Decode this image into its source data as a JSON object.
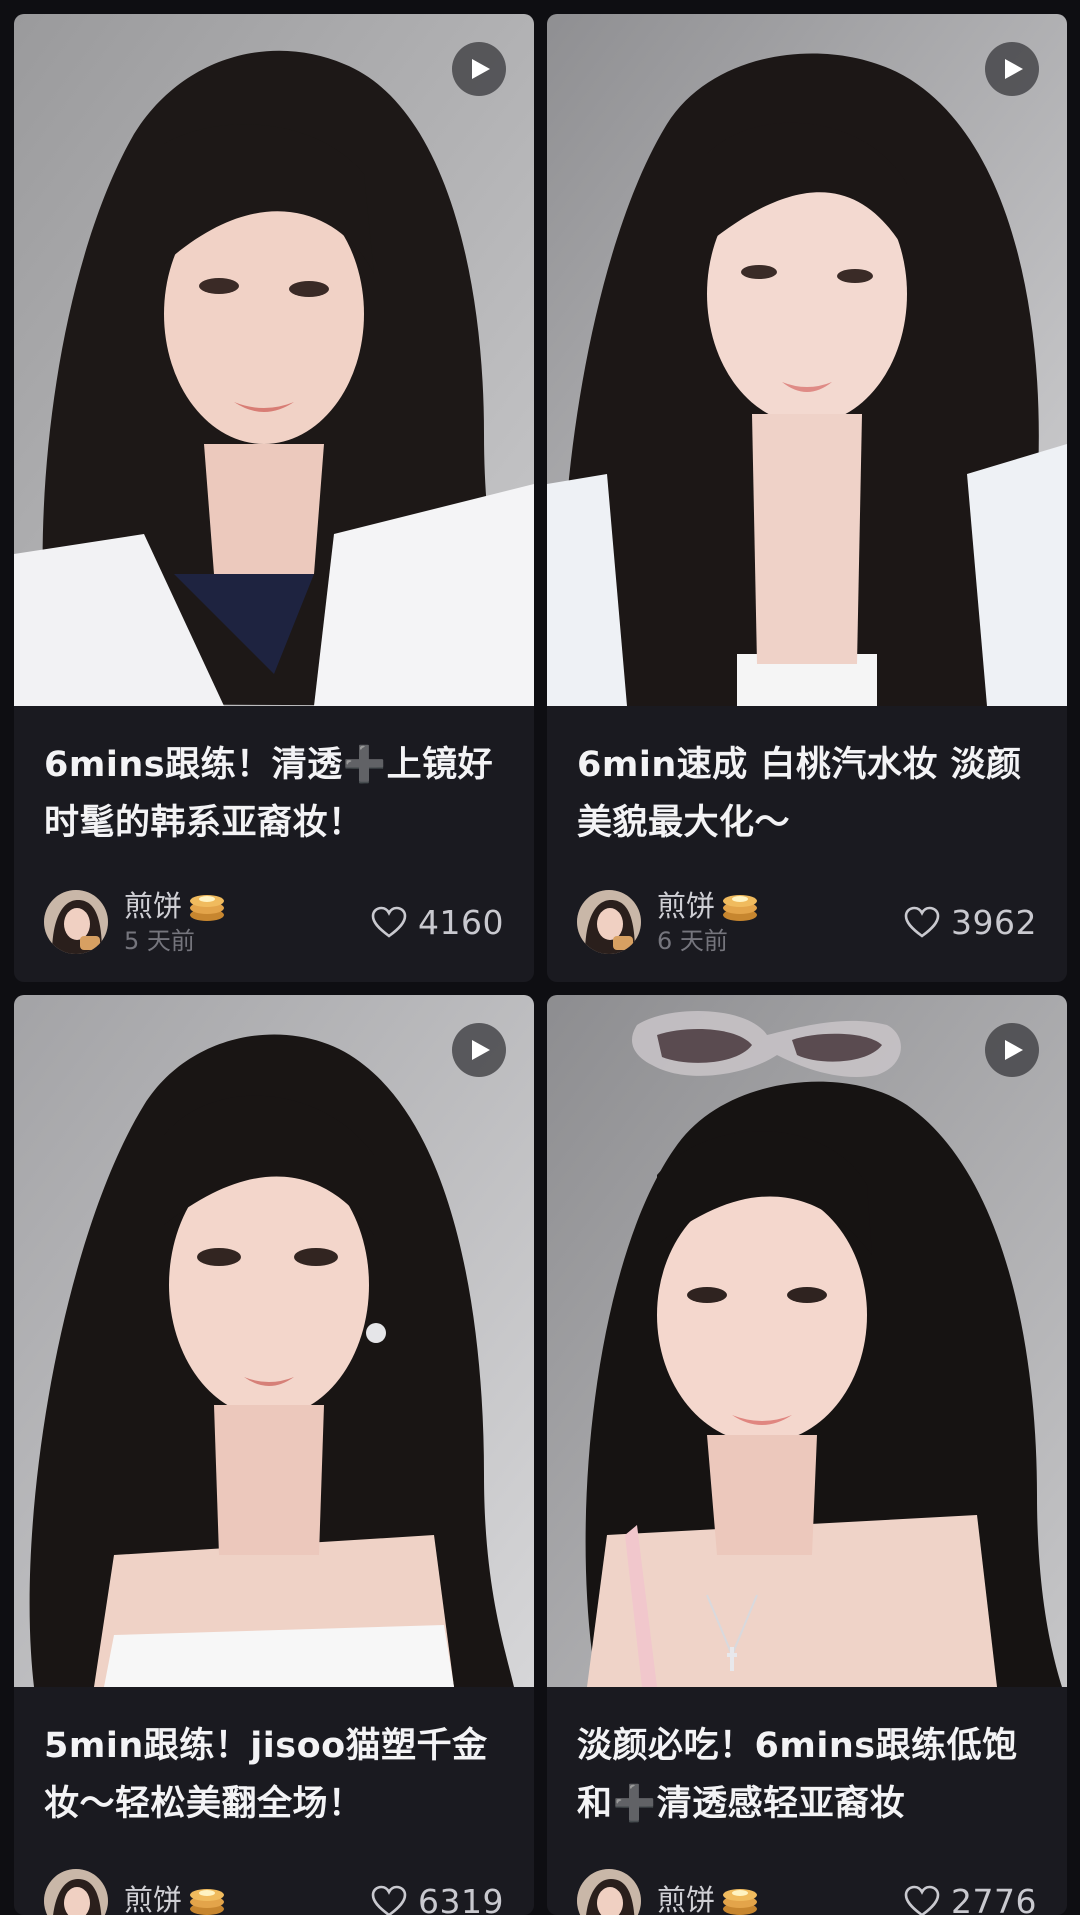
{
  "feed": {
    "cards": [
      {
        "title": "6mins跟练！清透➕上镜好时髦的韩系亚裔妆！",
        "author": "煎饼",
        "author_badge_icon": "pancake-emoji-icon",
        "time": "5 天前",
        "likes": "4160",
        "media_icon": "play-icon"
      },
      {
        "title": "6min速成 白桃汽水妆 淡颜美貌最大化～",
        "author": "煎饼",
        "author_badge_icon": "pancake-emoji-icon",
        "time": "6 天前",
        "likes": "3962",
        "media_icon": "play-icon"
      },
      {
        "title": "5min跟练！jisoo猫塑千金妆～轻松美翻全场！",
        "author": "煎饼",
        "author_badge_icon": "pancake-emoji-icon",
        "time": "",
        "likes": "6319",
        "media_icon": "play-icon"
      },
      {
        "title": "淡颜必吃！6mins跟练低饱和➕清透感轻亚裔妆",
        "author": "煎饼",
        "author_badge_icon": "pancake-emoji-icon",
        "time": "",
        "likes": "2776",
        "media_icon": "play-icon"
      }
    ]
  },
  "colors": {
    "background": "#0e0e12",
    "card": "#1a1a20",
    "title_text": "#f3f3f5",
    "secondary_text": "#75757d"
  }
}
